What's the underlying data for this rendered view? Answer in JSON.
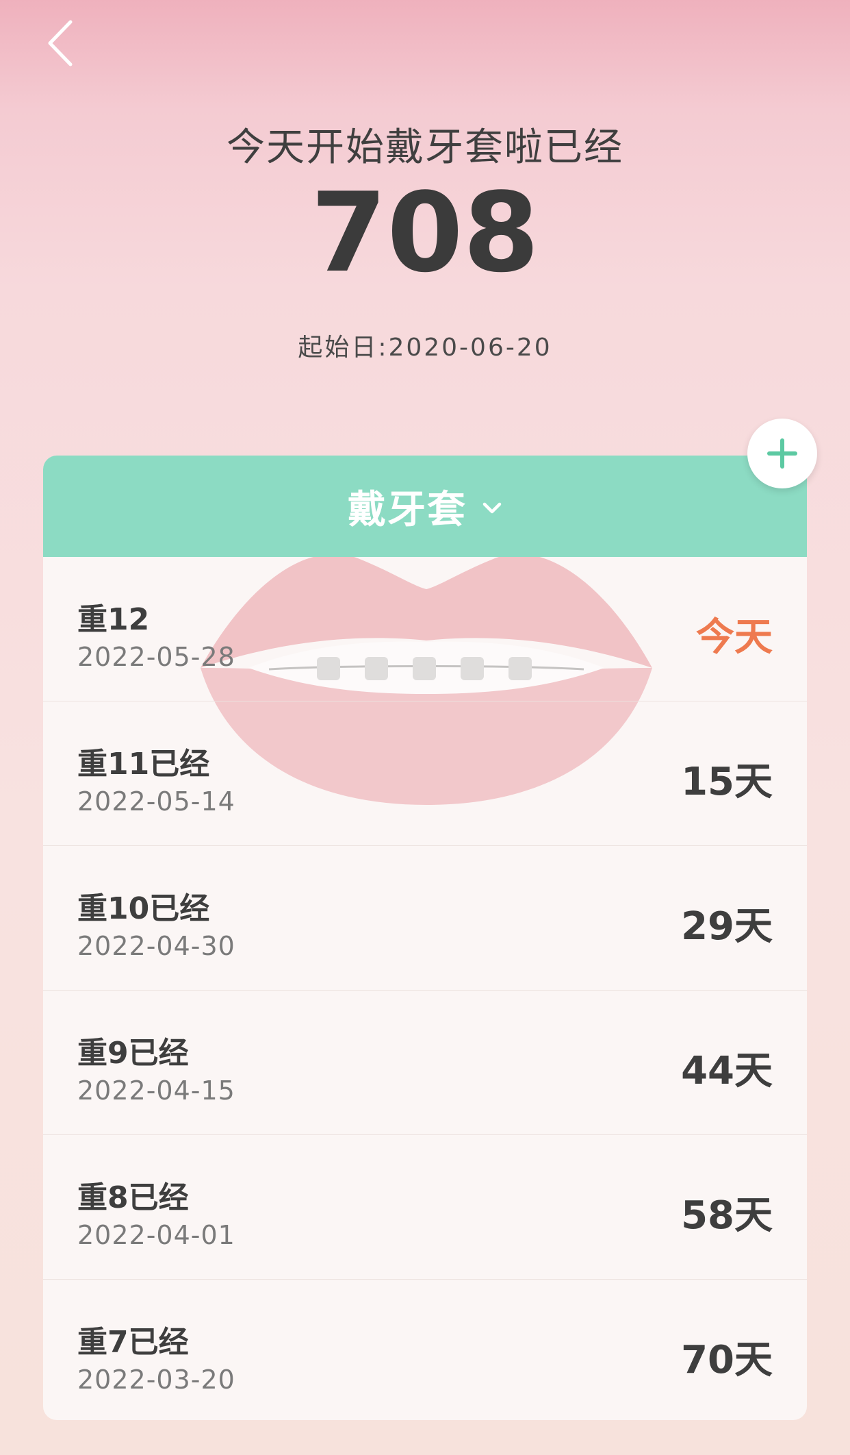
{
  "header": {
    "title": "今天开始戴牙套啦已经",
    "day_count": "708",
    "start_date": "起始日:2020-06-20"
  },
  "card": {
    "category": "戴牙套",
    "rows": [
      {
        "title": "重12",
        "date": "2022-05-28",
        "days": "今天"
      },
      {
        "title": "重11已经",
        "date": "2022-05-14",
        "days": "15天"
      },
      {
        "title": "重10已经",
        "date": "2022-04-30",
        "days": "29天"
      },
      {
        "title": "重9已经",
        "date": "2022-04-15",
        "days": "44天"
      },
      {
        "title": "重8已经",
        "date": "2022-04-01",
        "days": "58天"
      },
      {
        "title": "重7已经",
        "date": "2022-03-20",
        "days": "70天"
      }
    ]
  },
  "icons": {
    "back": "chevron-left-icon",
    "dropdown": "chevron-down-icon",
    "add": "plus-icon",
    "background": "lips-braces-illustration"
  },
  "colors": {
    "accent": "#8cdbc3",
    "today": "#ee7a4f",
    "text": "#3e3e3e"
  }
}
